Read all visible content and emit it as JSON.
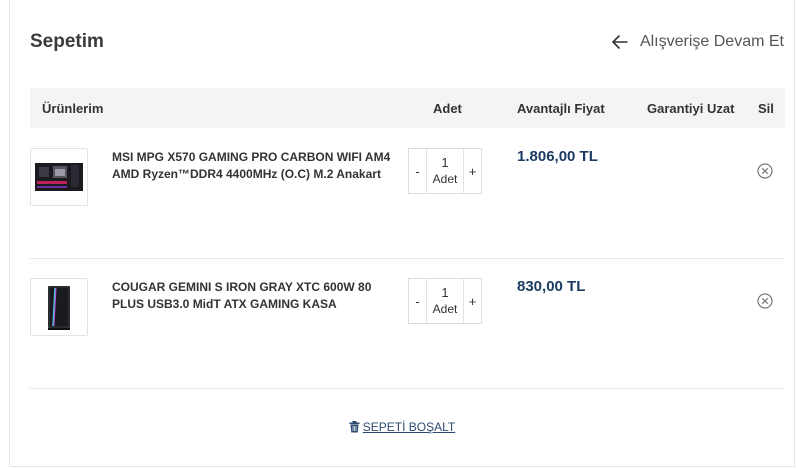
{
  "header": {
    "title": "Sepetim",
    "continue_label": "Alışverişe Devam Et"
  },
  "table": {
    "columns": {
      "products": "Ürünlerim",
      "quantity": "Adet",
      "price": "Avantajlı Fiyat",
      "warranty": "Garantiyi Uzat",
      "delete": "Sil"
    }
  },
  "items": [
    {
      "name": "MSI MPG X570 GAMING PRO CARBON WIFI AM4 AMD Ryzen™DDR4 4400MHz (O.C) M.2 Anakart",
      "quantity": "1",
      "unit": "Adet",
      "minus": "-",
      "plus": "+",
      "price": "1.806,00 TL"
    },
    {
      "name": "COUGAR GEMINI S IRON GRAY XTC 600W 80 PLUS USB3.0 MidT ATX GAMING KASA",
      "quantity": "1",
      "unit": "Adet",
      "minus": "-",
      "plus": "+",
      "price": "830,00 TL"
    }
  ],
  "footer": {
    "empty_cart_label": "SEPETİ BOŞALT"
  },
  "colors": {
    "price": "#1d3c63",
    "link": "#2d4a72",
    "header_bg": "#f4f4f4"
  },
  "icons": {
    "back": "arrow-left-icon",
    "remove": "circle-x-icon",
    "trash": "trash-icon"
  }
}
